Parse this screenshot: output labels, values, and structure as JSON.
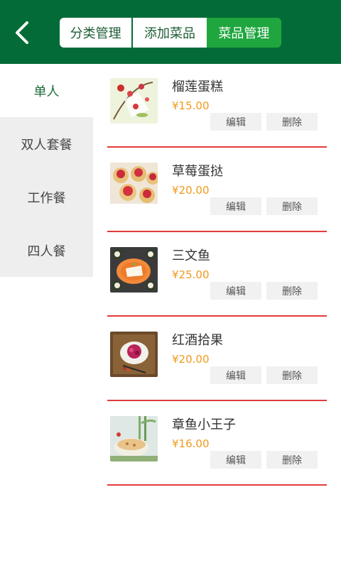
{
  "header": {
    "tabs": [
      {
        "label": "分类管理"
      },
      {
        "label": "添加菜品"
      },
      {
        "label": "菜品管理"
      }
    ],
    "active_tab": 2
  },
  "sidebar": {
    "items": [
      {
        "label": "单人"
      },
      {
        "label": "双人套餐"
      },
      {
        "label": "工作餐"
      },
      {
        "label": "四人餐"
      }
    ],
    "active": 0
  },
  "dishes": [
    {
      "name": "榴莲蛋糕",
      "price": "¥15.00",
      "edit_label": "编辑",
      "delete_label": "删除"
    },
    {
      "name": "草莓蛋挞",
      "price": "¥20.00",
      "edit_label": "编辑",
      "delete_label": "删除"
    },
    {
      "name": "三文鱼",
      "price": "¥25.00",
      "edit_label": "编辑",
      "delete_label": "删除"
    },
    {
      "name": "红酒拾果",
      "price": "¥20.00",
      "edit_label": "编辑",
      "delete_label": "删除"
    },
    {
      "name": "章鱼小王子",
      "price": "¥16.00",
      "edit_label": "编辑",
      "delete_label": "删除"
    }
  ],
  "colors": {
    "header_bg": "#036b37",
    "active_tab_bg": "#1fa63e",
    "price": "#ef9a1d",
    "separator": "#e23b3b",
    "sidebar_inactive_bg": "#eeeeee"
  },
  "icons": {
    "back": "chevron-left-icon"
  }
}
